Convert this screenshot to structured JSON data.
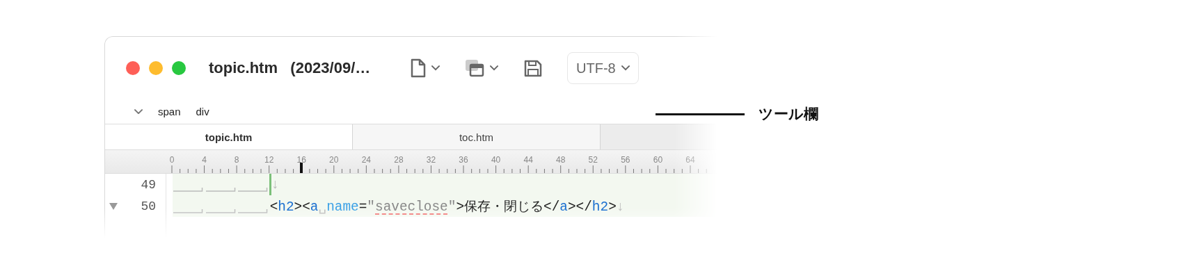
{
  "window": {
    "title": "topic.htm   (2023/09/…"
  },
  "toolbar": {
    "encoding": "UTF-8"
  },
  "breadcrumb": [
    "span",
    "div"
  ],
  "tabs": [
    {
      "label": "topic.htm",
      "selected": true
    },
    {
      "label": "toc.htm",
      "selected": false
    }
  ],
  "ruler": [
    "0",
    "4",
    "8",
    "12",
    "16",
    "20",
    "24",
    "28",
    "32",
    "36",
    "40",
    "44",
    "48",
    "52",
    "56",
    "60",
    "64"
  ],
  "lines": [
    {
      "number": "49",
      "foldable": false,
      "cursor": true,
      "indent": [
        {
          "kind": "tab"
        },
        {
          "kind": "tab"
        },
        {
          "kind": "tab"
        }
      ],
      "tokens": [
        {
          "kind": "eol",
          "text": "↓"
        }
      ]
    },
    {
      "number": "50",
      "foldable": true,
      "cursor": false,
      "indent": [
        {
          "kind": "tab"
        },
        {
          "kind": "tab"
        },
        {
          "kind": "tab"
        }
      ],
      "tokens": [
        {
          "kind": "punct",
          "text": "<"
        },
        {
          "kind": "tag",
          "text": "h2"
        },
        {
          "kind": "punct",
          "text": "><"
        },
        {
          "kind": "tag",
          "text": "a"
        },
        {
          "kind": "space",
          "text": "␣"
        },
        {
          "kind": "attr",
          "text": "name"
        },
        {
          "kind": "punct",
          "text": "="
        },
        {
          "kind": "string",
          "text": "\""
        },
        {
          "kind": "string",
          "text": "saveclose",
          "misspelled": true
        },
        {
          "kind": "string",
          "text": "\""
        },
        {
          "kind": "punct",
          "text": ">保存・閉じる</"
        },
        {
          "kind": "tag",
          "text": "a"
        },
        {
          "kind": "punct",
          "text": "></"
        },
        {
          "kind": "tag",
          "text": "h2"
        },
        {
          "kind": "punct",
          "text": ">"
        },
        {
          "kind": "eol",
          "text": "↓"
        }
      ]
    }
  ],
  "annotation": {
    "label": "ツール欄"
  }
}
